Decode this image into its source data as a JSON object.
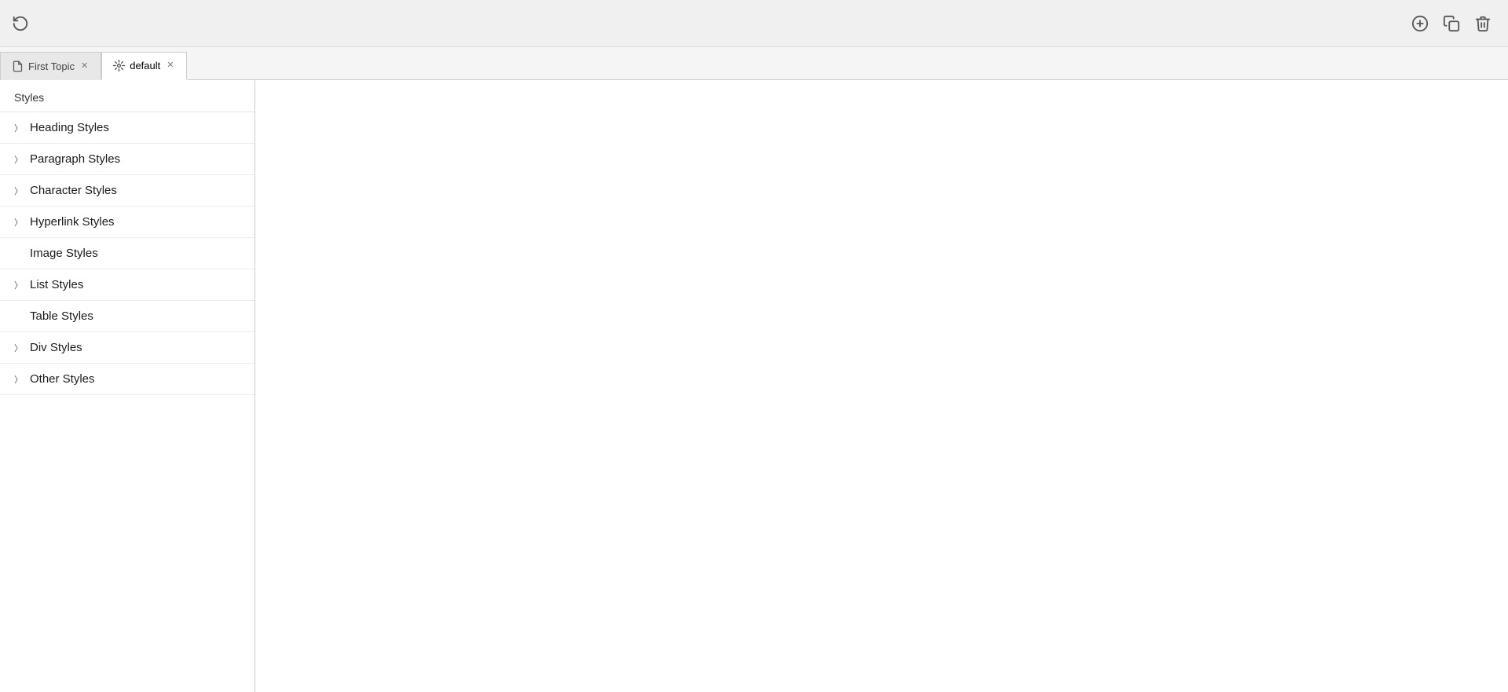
{
  "toolbar": {
    "add_label": "+",
    "copy_label": "⧉",
    "delete_label": "🗑"
  },
  "tabs": [
    {
      "id": "first-topic",
      "label": "First Topic",
      "icon": "document-icon",
      "closable": true,
      "active": false
    },
    {
      "id": "default",
      "label": "default",
      "icon": "styles-icon",
      "closable": true,
      "active": true
    }
  ],
  "sidebar": {
    "title": "Styles",
    "groups": [
      {
        "id": "heading-styles",
        "label": "Heading Styles",
        "hasArrow": true
      },
      {
        "id": "paragraph-styles",
        "label": "Paragraph Styles",
        "hasArrow": true
      },
      {
        "id": "character-styles",
        "label": "Character Styles",
        "hasArrow": true
      },
      {
        "id": "hyperlink-styles",
        "label": "Hyperlink Styles",
        "hasArrow": true
      },
      {
        "id": "image-styles",
        "label": "Image Styles",
        "hasArrow": false
      },
      {
        "id": "list-styles",
        "label": "List Styles",
        "hasArrow": true
      },
      {
        "id": "table-styles",
        "label": "Table Styles",
        "hasArrow": false
      },
      {
        "id": "div-styles",
        "label": "Div Styles",
        "hasArrow": true
      },
      {
        "id": "other-styles",
        "label": "Other Styles",
        "hasArrow": true
      }
    ]
  }
}
